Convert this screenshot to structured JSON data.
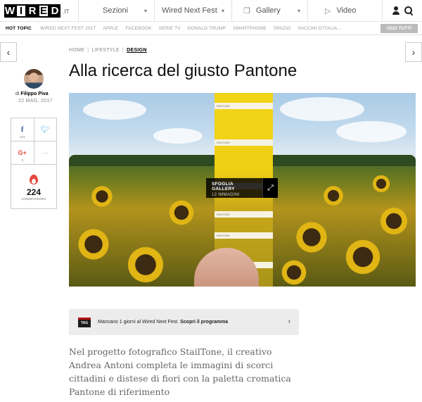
{
  "nav": {
    "logo_letters": [
      "W",
      "I",
      "R",
      "E",
      "D"
    ],
    "logo_suffix": ".IT",
    "items": [
      {
        "label": "Sezioni"
      },
      {
        "label": "Wired Next Fest"
      },
      {
        "label": "Gallery"
      },
      {
        "label": "Video"
      }
    ]
  },
  "topics": {
    "hot_label": "HOT TOPIC",
    "items": [
      "WIRED NEXT FEST 2017",
      "APPLE",
      "FACEBOOK",
      "SERIE TV",
      "DONALD TRUMP",
      "SMARTPHONE",
      "SPAZIO",
      "VACCINI D'ITALIA..."
    ],
    "see_all": "VEDI TUTTI"
  },
  "breadcrumb": {
    "home": "HOME",
    "lifestyle": "LIFESTYLE",
    "design": "DESIGN"
  },
  "article": {
    "title": "Alla ricerca del giusto Pantone",
    "author_prefix": "di",
    "author": "Filippo Piva",
    "date": "22 MAG, 2017",
    "lead": "Nel progetto fotografico StailTone, il creativo Andrea Antoni completa le immagini di scorci cittadini e distese di fiori con la paletta cromatica Pantone di riferimento"
  },
  "share": {
    "facebook_count": "224",
    "twitter_count": "",
    "gplus_count": "0",
    "total": "224",
    "total_label": "CONDIVISIONI"
  },
  "gallery": {
    "title": "SFOGLIA GALLERY",
    "count": "12 IMMAGINI"
  },
  "swatches": [
    "PANTONE",
    "PANTONE",
    "PANTONE",
    "PANTONE",
    "PANTONE",
    "PANTONE"
  ],
  "banner": {
    "logo": "TAG",
    "text": "Mancano 1 giorni al Wired Next Fest.",
    "link": "Scopri il programma"
  },
  "colors": {
    "facebook": "#3b5998",
    "twitter": "#55acee",
    "gplus": "#dd4b39",
    "flame": "#e7453b"
  }
}
